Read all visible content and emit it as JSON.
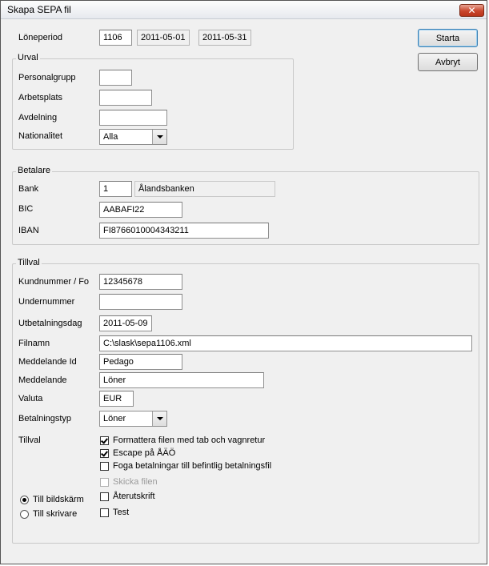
{
  "window": {
    "title": "Skapa SEPA fil",
    "close_label": "✕"
  },
  "buttons": {
    "start": "Starta",
    "cancel": "Avbryt"
  },
  "loneperiod": {
    "label": "Löneperiod",
    "value": "1106",
    "from": "2011-05-01",
    "to": "2011-05-31"
  },
  "urval": {
    "legend": "Urval",
    "personalgrupp": {
      "label": "Personalgrupp",
      "value": ""
    },
    "arbetsplats": {
      "label": "Arbetsplats",
      "value": ""
    },
    "avdelning": {
      "label": "Avdelning",
      "value": ""
    },
    "nationalitet": {
      "label": "Nationalitet",
      "value": "Alla"
    }
  },
  "betalare": {
    "legend": "Betalare",
    "bank": {
      "label": "Bank",
      "value": "1",
      "name": "Ålandsbanken"
    },
    "bic": {
      "label": "BIC",
      "value": "AABAFI22"
    },
    "iban": {
      "label": "IBAN",
      "value": "FI8766010004343211"
    }
  },
  "tillval": {
    "legend": "Tillval",
    "kundnummer": {
      "label": "Kundnummer / Fo",
      "value": "12345678"
    },
    "undernummer": {
      "label": "Undernummer",
      "value": ""
    },
    "utbetalningsdag": {
      "label": "Utbetalningsdag",
      "value": "2011-05-09"
    },
    "filnamn": {
      "label": "Filnamn",
      "value": "C:\\slask\\sepa1106.xml"
    },
    "meddelande_id": {
      "label": "Meddelande Id",
      "value": "Pedago"
    },
    "meddelande": {
      "label": "Meddelande",
      "value": "Löner"
    },
    "valuta": {
      "label": "Valuta",
      "value": "EUR"
    },
    "betalningstyp": {
      "label": "Betalningstyp",
      "value": "Löner"
    },
    "options_label": "Tillval",
    "options": [
      {
        "label": "Formattera filen med tab och vagnretur",
        "checked": true
      },
      {
        "label": "Escape på ÅÄÖ",
        "checked": true
      },
      {
        "label": "Foga betalningar till befintlig betalningsfil",
        "checked": false
      },
      {
        "label": "Skicka filen",
        "checked": false,
        "disabled": true
      },
      {
        "label": "Återutskrift",
        "checked": false
      },
      {
        "label": "Test",
        "checked": false
      }
    ],
    "output": [
      {
        "label": "Till bildskärm",
        "selected": true
      },
      {
        "label": "Till skrivare",
        "selected": false
      }
    ]
  }
}
